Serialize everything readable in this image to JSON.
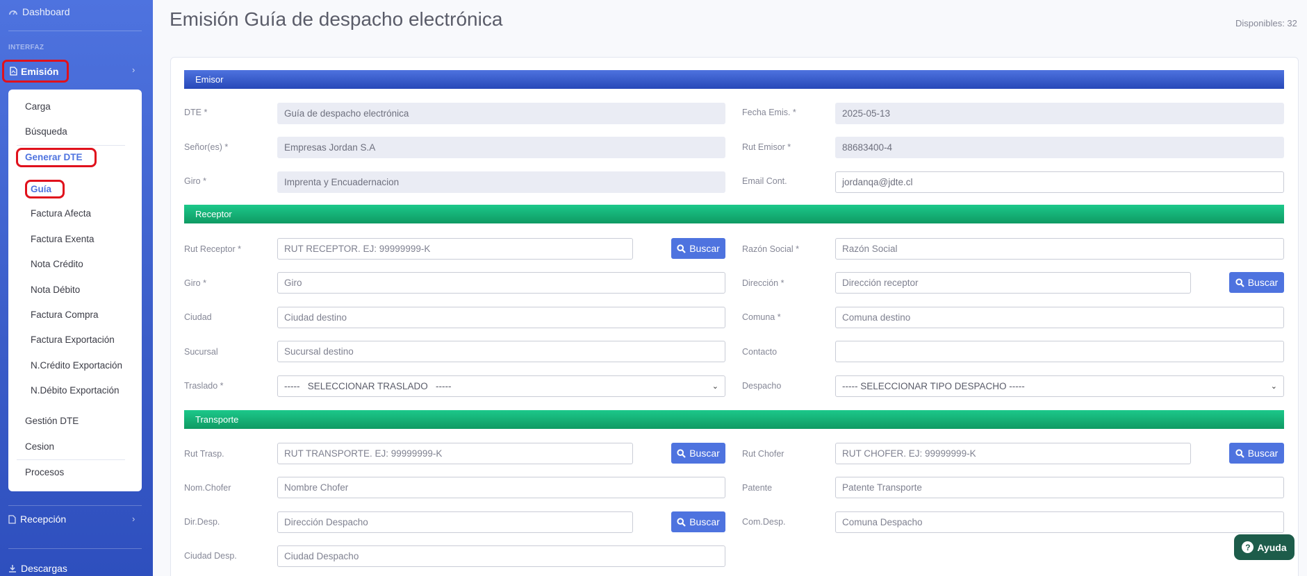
{
  "sidebar": {
    "dashboard": "Dashboard",
    "heading": "INTERFAZ",
    "emision": "Emisión",
    "collapse": {
      "carga": "Carga",
      "busqueda": "Búsqueda",
      "generar": "Generar DTE",
      "items": [
        "Guía",
        "Factura Afecta",
        "Factura Exenta",
        "Nota Crédito",
        "Nota Débito",
        "Factura Compra",
        "Factura Exportación",
        "N.Crédito Exportación",
        "N.Débito Exportación"
      ],
      "gestion": "Gestión DTE",
      "cesion": "Cesion",
      "procesos": "Procesos"
    },
    "recepcion": "Recepción",
    "descargas": "Descargas"
  },
  "header": {
    "title": "Emisión Guía de despacho electrónica",
    "disponibles": "Disponibles: 32"
  },
  "sections": {
    "emisor": "Emisor",
    "receptor": "Receptor",
    "transporte": "Transporte"
  },
  "emisor": {
    "dte": {
      "label": "DTE *",
      "value": "Guía de despacho electrónica"
    },
    "fecha": {
      "label": "Fecha Emis. *",
      "value": "2025-05-13"
    },
    "senores": {
      "label": "Señor(es) *",
      "value": "Empresas Jordan S.A"
    },
    "rut": {
      "label": "Rut Emisor *",
      "value": "88683400-4"
    },
    "giro": {
      "label": "Giro *",
      "value": "Imprenta y Encuadernacion"
    },
    "email": {
      "label": "Email Cont.",
      "value": "jordanqa@jdte.cl"
    }
  },
  "receptor": {
    "rut": {
      "label": "Rut Receptor *",
      "placeholder": "RUT RECEPTOR. EJ: 99999999-K"
    },
    "razon": {
      "label": "Razón Social *",
      "placeholder": "Razón Social"
    },
    "giro": {
      "label": "Giro *",
      "placeholder": "Giro"
    },
    "direccion": {
      "label": "Dirección *",
      "placeholder": "Dirección receptor"
    },
    "ciudad": {
      "label": "Ciudad",
      "placeholder": "Ciudad destino"
    },
    "comuna": {
      "label": "Comuna *",
      "placeholder": "Comuna destino"
    },
    "sucursal": {
      "label": "Sucursal",
      "placeholder": "Sucursal destino"
    },
    "contacto": {
      "label": "Contacto",
      "placeholder": ""
    },
    "traslado": {
      "label": "Traslado *",
      "selected": "-----   SELECCIONAR TRASLADO   -----"
    },
    "despacho": {
      "label": "Despacho",
      "selected": "----- SELECCIONAR TIPO DESPACHO -----"
    }
  },
  "transporte": {
    "rut": {
      "label": "Rut Trasp.",
      "placeholder": "RUT TRANSPORTE. EJ: 99999999-K"
    },
    "rutchofer": {
      "label": "Rut Chofer",
      "placeholder": "RUT CHOFER. EJ: 99999999-K"
    },
    "nomchofer": {
      "label": "Nom.Chofer",
      "placeholder": "Nombre Chofer"
    },
    "patente": {
      "label": "Patente",
      "placeholder": "Patente Transporte"
    },
    "dirdesp": {
      "label": "Dir.Desp.",
      "placeholder": "Dirección Despacho"
    },
    "comdesp": {
      "label": "Com.Desp.",
      "placeholder": "Comuna Despacho"
    },
    "ciudaddesp": {
      "label": "Ciudad Desp.",
      "placeholder": "Ciudad Despacho"
    }
  },
  "buttons": {
    "buscar": "Buscar",
    "ayuda": "Ayuda"
  },
  "colors": {
    "primary": "#4e73df",
    "success": "#1cc88a",
    "highlight": "#e0111c",
    "help": "#1d5c4a"
  }
}
